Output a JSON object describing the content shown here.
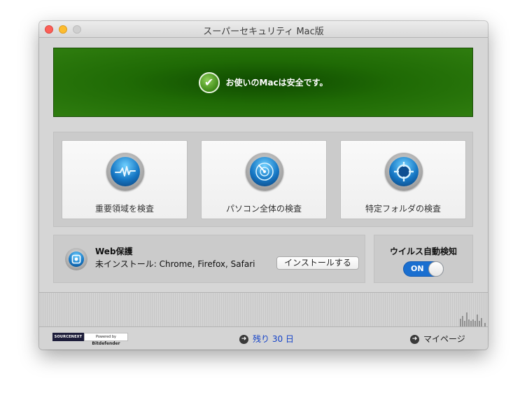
{
  "window": {
    "title": "スーパーセキュリティ Mac版"
  },
  "status": {
    "message": "お使いのMacは安全です。"
  },
  "scans": [
    {
      "label": "重要領域を検査",
      "icon": "pulse-icon"
    },
    {
      "label": "パソコン全体の検査",
      "icon": "radar-icon"
    },
    {
      "label": "特定フォルダの検査",
      "icon": "target-icon"
    }
  ],
  "web_protection": {
    "title": "Web保護",
    "status": "未インストール: Chrome, Firefox, Safari",
    "install_label": "インストールする"
  },
  "antivirus": {
    "title": "ウイルス自動検知",
    "toggle_label": "ON"
  },
  "footer": {
    "logo_sourcenext": "SOURCENEXT",
    "powered_by": "Powered by",
    "logo_bitdefender": "Bitdefender",
    "days_left": "残り 30 日",
    "mypage": "マイページ"
  },
  "colors": {
    "banner": "#1f6a05",
    "accent_blue": "#1a6fd0",
    "link_blue": "#1442c8"
  }
}
